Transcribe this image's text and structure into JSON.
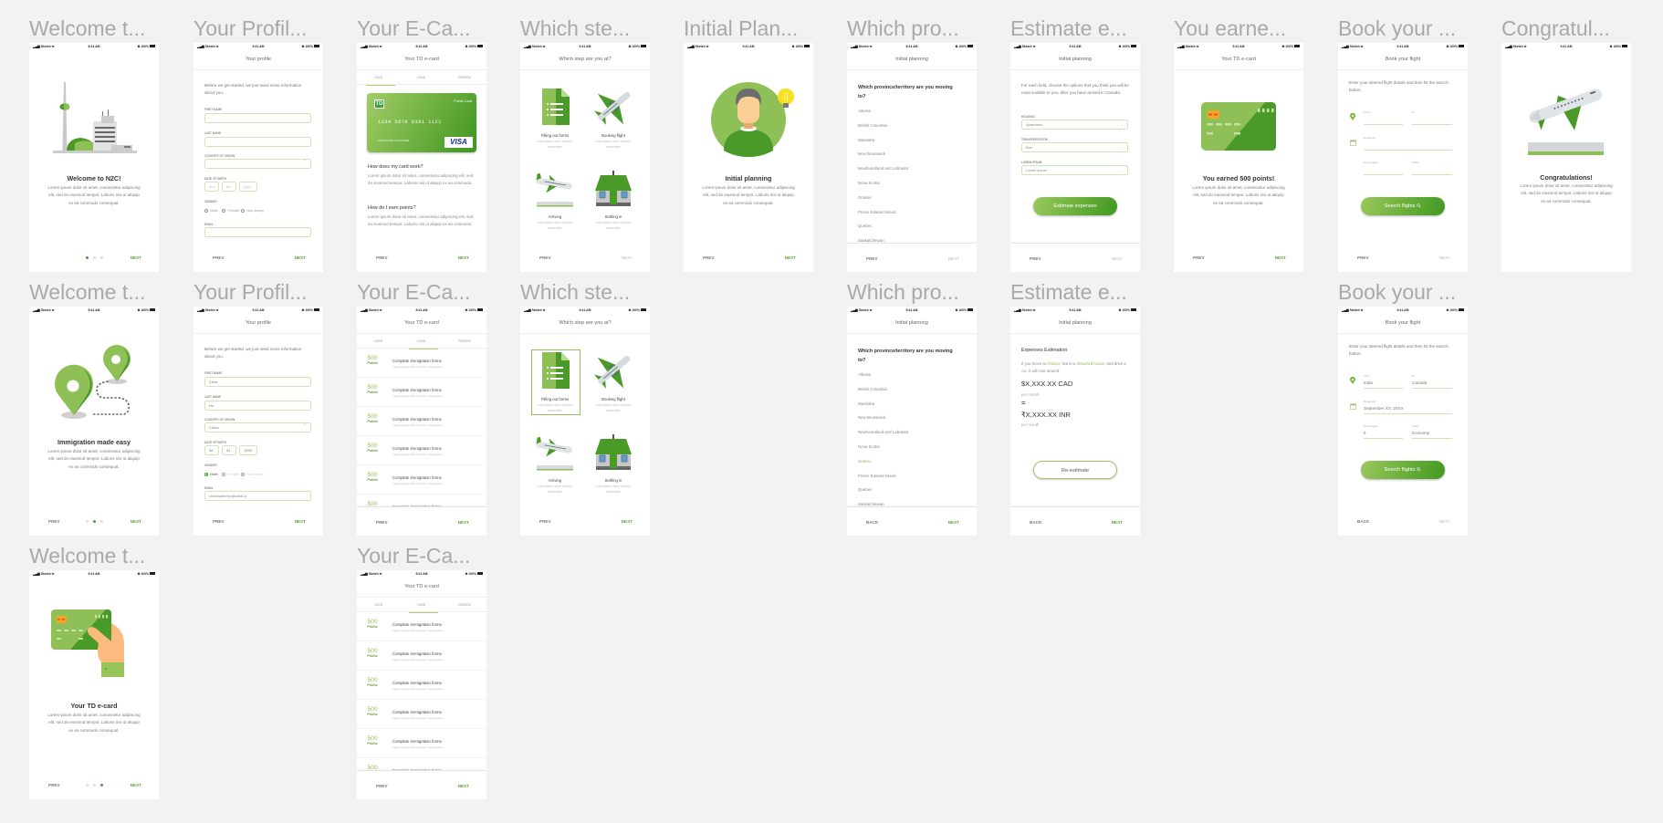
{
  "colors": {
    "green": "#4c9c2e",
    "light_green": "#8fc057",
    "field_border": "#cfe4b8",
    "canvas": "#f2f2f2"
  },
  "status_bar": {
    "carrier": "Sketch",
    "time": "9:41 AM",
    "battery": "100%"
  },
  "artboards": [
    {
      "label": "Welcome t...",
      "type": "onboard",
      "illustration": "city",
      "heading": "Welcome to N2C!",
      "body": "Lorem ipsum dolor sit amet, consectetur adipiscing elit, sed do eiusmod tempor. Laboris nisi ut aliquip ex ea commodo consequat.",
      "footer": {
        "left": null,
        "right": "NEXT",
        "right_enabled": true,
        "dots_active": 0
      }
    },
    {
      "label": "Your Profil...",
      "type": "profile",
      "header": "Your profile",
      "intro": "Before we get started, we just need some information about you.",
      "labels": {
        "first": "FIRST NAME",
        "last": "LAST NAME",
        "country": "COUNTRY OF ORIGIN",
        "dob": "DATE OF BIRTH",
        "gender": "GENDER",
        "email": "EMAIL"
      },
      "values": {
        "first": "",
        "last": "",
        "country": "",
        "email": ""
      },
      "dob": [
        "mm",
        "dd",
        "yyyy"
      ],
      "dob_placeholder": true,
      "genders": [
        "Male",
        "Female",
        "Non-binary"
      ],
      "gender_selected": null,
      "footer": {
        "left": "PREV",
        "right": "NEXT",
        "right_enabled": true
      }
    },
    {
      "label": "Your E-Ca...",
      "type": "card",
      "header": "Your TD e-card",
      "tabs": [
        "CARD",
        "EARN",
        "REDEEM"
      ],
      "active_tab": 0,
      "card": {
        "brand": "TD",
        "kind": "Points Card",
        "number": "1234 5678 9181 1121",
        "holder": "FIRSTNAME LASTNAME",
        "network": "VISA"
      },
      "faq": [
        {
          "q": "How does my card work?",
          "a": "Lorem ipsum dolor sit amet, consectetur adipiscing elit, sed do eiusmod tempor. Laboris nisi ut aliquip ex ea commodo."
        },
        {
          "q": "How do I earn points?",
          "a": "Lorem ipsum dolor sit amet, consectetur adipiscing elit, sed do eiusmod tempor. Laboris nisi ut aliquip ex ea commodo."
        }
      ],
      "footer": {
        "left": "PREV",
        "right": "NEXT",
        "right_enabled": true
      }
    },
    {
      "label": "Which ste...",
      "type": "steps",
      "header": "Which step are you at?",
      "steps": [
        {
          "title": "Filling out forms",
          "desc": "Lorem ipsum dolor sit amet, consectetur"
        },
        {
          "title": "Booking flight",
          "desc": "Lorem ipsum dolor sit amet, consectetur"
        },
        {
          "title": "Arriving",
          "desc": "Lorem ipsum dolor sit amet, consectetur"
        },
        {
          "title": "Settling in",
          "desc": "Lorem ipsum dolor sit amet, consectetur"
        }
      ],
      "selected": null,
      "footer": {
        "left": "PREV",
        "right": "NEXT",
        "right_enabled": false
      }
    },
    {
      "label": "Initial Plan...",
      "type": "onboard",
      "illustration": "person",
      "heading": "Initial planning",
      "body": "Lorem ipsum dolor sit amet, consectetur adipiscing elit, sed do eiusmod tempor. Laboris nisi ut aliquip ex ea commodo consequat.",
      "footer": {
        "left": "PREV",
        "right": "NEXT",
        "right_enabled": true
      }
    },
    {
      "label": "Which pro...",
      "type": "provinces",
      "header": "Initial planning",
      "question": "Which province/territory are you moving to?",
      "provinces": [
        "Alberta",
        "British Columbia",
        "Manitoba",
        "New Brunswick",
        "Newfoundland and Labrador",
        "Nova Scotia",
        "Ontario",
        "Prince Edward Island",
        "Quebec",
        "Saskatchewan"
      ],
      "selected": null,
      "footer": {
        "left": "PREV",
        "right": "NEXT",
        "right_enabled": false
      }
    },
    {
      "label": "Estimate e...",
      "type": "estimate_form",
      "header": "Initial planning",
      "intro": "For each field, choose the options that you think you will be most suitable to you, after you have arrived in Canada.",
      "fields": [
        {
          "label": "HOUSING",
          "value": "Apartment"
        },
        {
          "label": "TRANSPORTATION",
          "value": "Bus"
        },
        {
          "label": "LOREM IPSUM",
          "value": "Lorem ipsum"
        }
      ],
      "button": "Estimate expenses",
      "footer": {
        "left": "PREV",
        "right": "NEXT",
        "right_enabled": false
      }
    },
    {
      "label": "You earne...",
      "type": "onboard",
      "header": "Your TD e-card",
      "illustration": "card",
      "heading": "You earned 500 points!",
      "body": "Lorem ipsum dolor sit amet, consectetur adipiscing elit, sed do eiusmod tempor. Laboris nisi ut aliquip ex ea commodo consequat.",
      "footer": {
        "left": "PREV",
        "right": "NEXT",
        "right_enabled": true
      }
    },
    {
      "label": "Book your ...",
      "type": "flight",
      "header": "Book your flight",
      "intro": "Enter your desired flight details and then hit the search button.",
      "fields": {
        "from": {
          "label": "From",
          "value": ""
        },
        "to": {
          "label": "To",
          "value": ""
        },
        "departure": {
          "label": "Departure",
          "value": ""
        },
        "passengers": {
          "label": "Passengers",
          "value": ""
        },
        "class": {
          "label": "Class",
          "value": ""
        }
      },
      "button": "Search flights",
      "footer": {
        "left": "PREV",
        "right": "NEXT",
        "right_enabled": false
      }
    },
    {
      "label": "Congratul...",
      "type": "onboard",
      "illustration": "takeoff",
      "heading": "Congratulations!",
      "body": "Lorem ipsum dolor sit amet, consectetur adipiscing elit, sed do eiusmod tempor. Laboris nisi ut aliquip ex ea commodo consequat.",
      "footer": null
    },
    {
      "label": "Welcome t...",
      "type": "onboard",
      "illustration": "pins",
      "heading": "Immigration made easy",
      "body": "Lorem ipsum dolor sit amet, consectetur adipiscing elit, sed do eiusmod tempor. Laboris nisi ut aliquip ex ea commodo consequat.",
      "footer": {
        "left": "PREV",
        "right": "NEXT",
        "right_enabled": true,
        "dots_active": 1
      }
    },
    {
      "label": "Your Profil...",
      "type": "profile",
      "header": "Your profile",
      "intro": "Before we get started, we just need some information about you.",
      "labels": {
        "first": "FIRST NAME",
        "last": "LAST NAME",
        "country": "COUNTRY OF ORIGIN",
        "dob": "DATE OF BIRTH",
        "gender": "GENDER",
        "email": "EMAIL"
      },
      "values": {
        "first": "Chris",
        "last": "Ho",
        "country": "China",
        "email": "christopherho@tdlab.io"
      },
      "dob": [
        "08",
        "31",
        "1999"
      ],
      "dob_placeholder": false,
      "genders": [
        "Male",
        "Female",
        "Non-binary"
      ],
      "gender_selected": 0,
      "footer": {
        "left": "PREV",
        "right": "NEXT",
        "right_enabled": true
      }
    },
    {
      "label": "Your E-Ca...",
      "type": "earn",
      "header": "Your TD e-card",
      "tabs": [
        "CARD",
        "EARN",
        "REDEEM"
      ],
      "active_tab": 1,
      "items": [
        {
          "points": "500",
          "unit": "Points",
          "title": "Complete immigration forms",
          "desc": "Lorem ipsum dolor sit amet, consectetur"
        },
        {
          "points": "500",
          "unit": "Points",
          "title": "Complete immigration forms",
          "desc": "Lorem ipsum dolor sit amet, consectetur"
        },
        {
          "points": "500",
          "unit": "Points",
          "title": "Complete immigration forms",
          "desc": "Lorem ipsum dolor sit amet, consectetur"
        },
        {
          "points": "500",
          "unit": "Points",
          "title": "Complete immigration forms",
          "desc": "Lorem ipsum dolor sit amet, consectetur"
        },
        {
          "points": "500",
          "unit": "Points",
          "title": "Complete immigration forms",
          "desc": "Lorem ipsum dolor sit amet, consectetur"
        },
        {
          "points": "500",
          "unit": "Points",
          "title": "Complete immigration forms",
          "desc": "Lorem ipsum dolor sit amet, consectetur"
        }
      ],
      "footer": {
        "left": "PREV",
        "right": "NEXT",
        "right_enabled": true
      }
    },
    {
      "label": "Which ste...",
      "type": "steps",
      "header": "Which step are you at?",
      "steps": [
        {
          "title": "Filling out forms",
          "desc": "Lorem ipsum dolor sit amet, consectetur"
        },
        {
          "title": "Booking flight",
          "desc": "Lorem ipsum dolor sit amet, consectetur"
        },
        {
          "title": "Arriving",
          "desc": "Lorem ipsum dolor sit amet, consectetur"
        },
        {
          "title": "Settling in",
          "desc": "Lorem ipsum dolor sit amet, consectetur"
        }
      ],
      "selected": 0,
      "footer": {
        "left": "PREV",
        "right": "NEXT",
        "right_enabled": true
      }
    },
    {
      "label": "Which pro...",
      "type": "provinces",
      "header": "Initial planning",
      "question": "Which province/territory are you moving to?",
      "provinces": [
        "Alberta",
        "British Columbia",
        "Manitoba",
        "New Brunswick",
        "Newfoundland and Labrador",
        "Nova Scotia",
        "Ontario",
        "Prince Edward Island",
        "Quebec",
        "Saskatchewan"
      ],
      "selected": 6,
      "footer": {
        "left": "BACK",
        "right": "NEXT",
        "right_enabled": true
      }
    },
    {
      "label": "Estimate e...",
      "type": "estimate_result",
      "header": "Initial planning",
      "title": "Expenses Estimation",
      "sentence": [
        "If you move to ",
        "Ontario",
        ", live in a ",
        "detached house",
        ", and drive a ",
        "car",
        ", it will cost around:"
      ],
      "amount_cad": "$X,XXX.XX CAD",
      "per_month": "per month",
      "equals": "=",
      "amount_inr": "₹X,XXX.XX INR",
      "button": "Re-estimate",
      "footer": {
        "left": "BACK",
        "right": "NEXT",
        "right_enabled": true
      }
    },
    {
      "label": "Book your ...",
      "type": "flight",
      "header": "Book your flight",
      "intro": "Enter your desired flight details and then hit the search button.",
      "fields": {
        "from": {
          "label": "From",
          "value": "India"
        },
        "to": {
          "label": "To",
          "value": "Canada"
        },
        "departure": {
          "label": "Departure",
          "value": "September XX, 20XX"
        },
        "passengers": {
          "label": "Passengers",
          "value": "5"
        },
        "class": {
          "label": "Class",
          "value": "Economy"
        }
      },
      "button": "Search flights",
      "footer": {
        "left": "BACK",
        "right": "NEXT",
        "right_enabled": false
      }
    },
    {
      "label": "Welcome t...",
      "type": "onboard",
      "illustration": "card-hand",
      "heading": "Your TD e-card",
      "body": "Lorem ipsum dolor sit amet, consectetur adipiscing elit, sed do eiusmod tempor. Laboris nisi ut aliquip ex ea commodo consequat.",
      "footer": {
        "left": "PREV",
        "right": "NEXT",
        "right_enabled": true,
        "dots_active": 2
      }
    },
    {
      "label": "Your E-Ca...",
      "type": "earn",
      "header": "Your TD e-card",
      "tabs": [
        "CARD",
        "EARN",
        "REDEEM"
      ],
      "active_tab": 1,
      "items": [
        {
          "points": "500",
          "unit": "Points",
          "title": "Complete immigration forms",
          "desc": "Lorem ipsum dolor sit amet, consectetur"
        },
        {
          "points": "500",
          "unit": "Points",
          "title": "Complete immigration forms",
          "desc": "Lorem ipsum dolor sit amet, consectetur"
        },
        {
          "points": "500",
          "unit": "Points",
          "title": "Complete immigration forms",
          "desc": "Lorem ipsum dolor sit amet, consectetur"
        },
        {
          "points": "500",
          "unit": "Points",
          "title": "Complete immigration forms",
          "desc": "Lorem ipsum dolor sit amet, consectetur"
        },
        {
          "points": "500",
          "unit": "Points",
          "title": "Complete immigration forms",
          "desc": "Lorem ipsum dolor sit amet, consectetur"
        },
        {
          "points": "500",
          "unit": "Points",
          "title": "Complete immigration forms",
          "desc": "Lorem ipsum dolor sit amet, consectetur"
        }
      ],
      "footer": {
        "left": "PREV",
        "right": "NEXT",
        "right_enabled": true
      }
    }
  ]
}
